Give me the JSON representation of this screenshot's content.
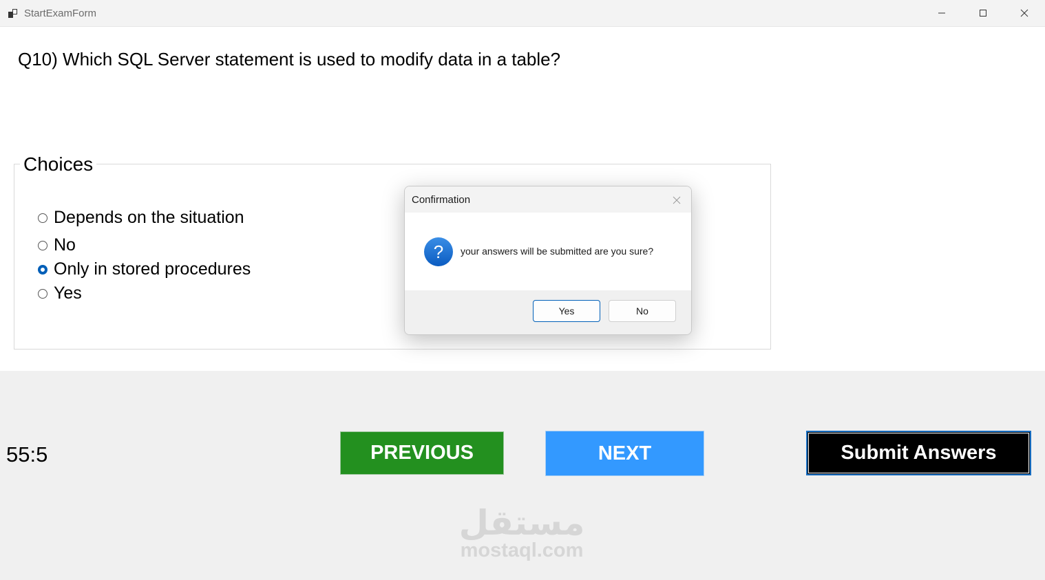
{
  "window": {
    "title": "StartExamForm",
    "icon": "app-form-icon"
  },
  "question": {
    "text": "Q10) Which SQL Server statement is used to modify data in a table?"
  },
  "choices": {
    "legend": "Choices",
    "items": [
      {
        "label": "Depends on the situation",
        "checked": false
      },
      {
        "label": "No",
        "checked": false
      },
      {
        "label": "Only in stored procedures",
        "checked": true
      },
      {
        "label": "Yes",
        "checked": false
      }
    ]
  },
  "timer": "55:5",
  "buttons": {
    "previous": "PREVIOUS",
    "next": "NEXT",
    "submit": "Submit Answers"
  },
  "colors": {
    "previous": "#23901f",
    "next": "#3399ff",
    "submit": "#000000",
    "accent": "#005fb8"
  },
  "watermark": {
    "arabic": "مستقل",
    "latin": "mostaql.com"
  },
  "dialog": {
    "title": "Confirmation",
    "icon": "question-icon",
    "message": "your answers will be submitted are you sure?",
    "yes_label": "Yes",
    "no_label": "No"
  }
}
